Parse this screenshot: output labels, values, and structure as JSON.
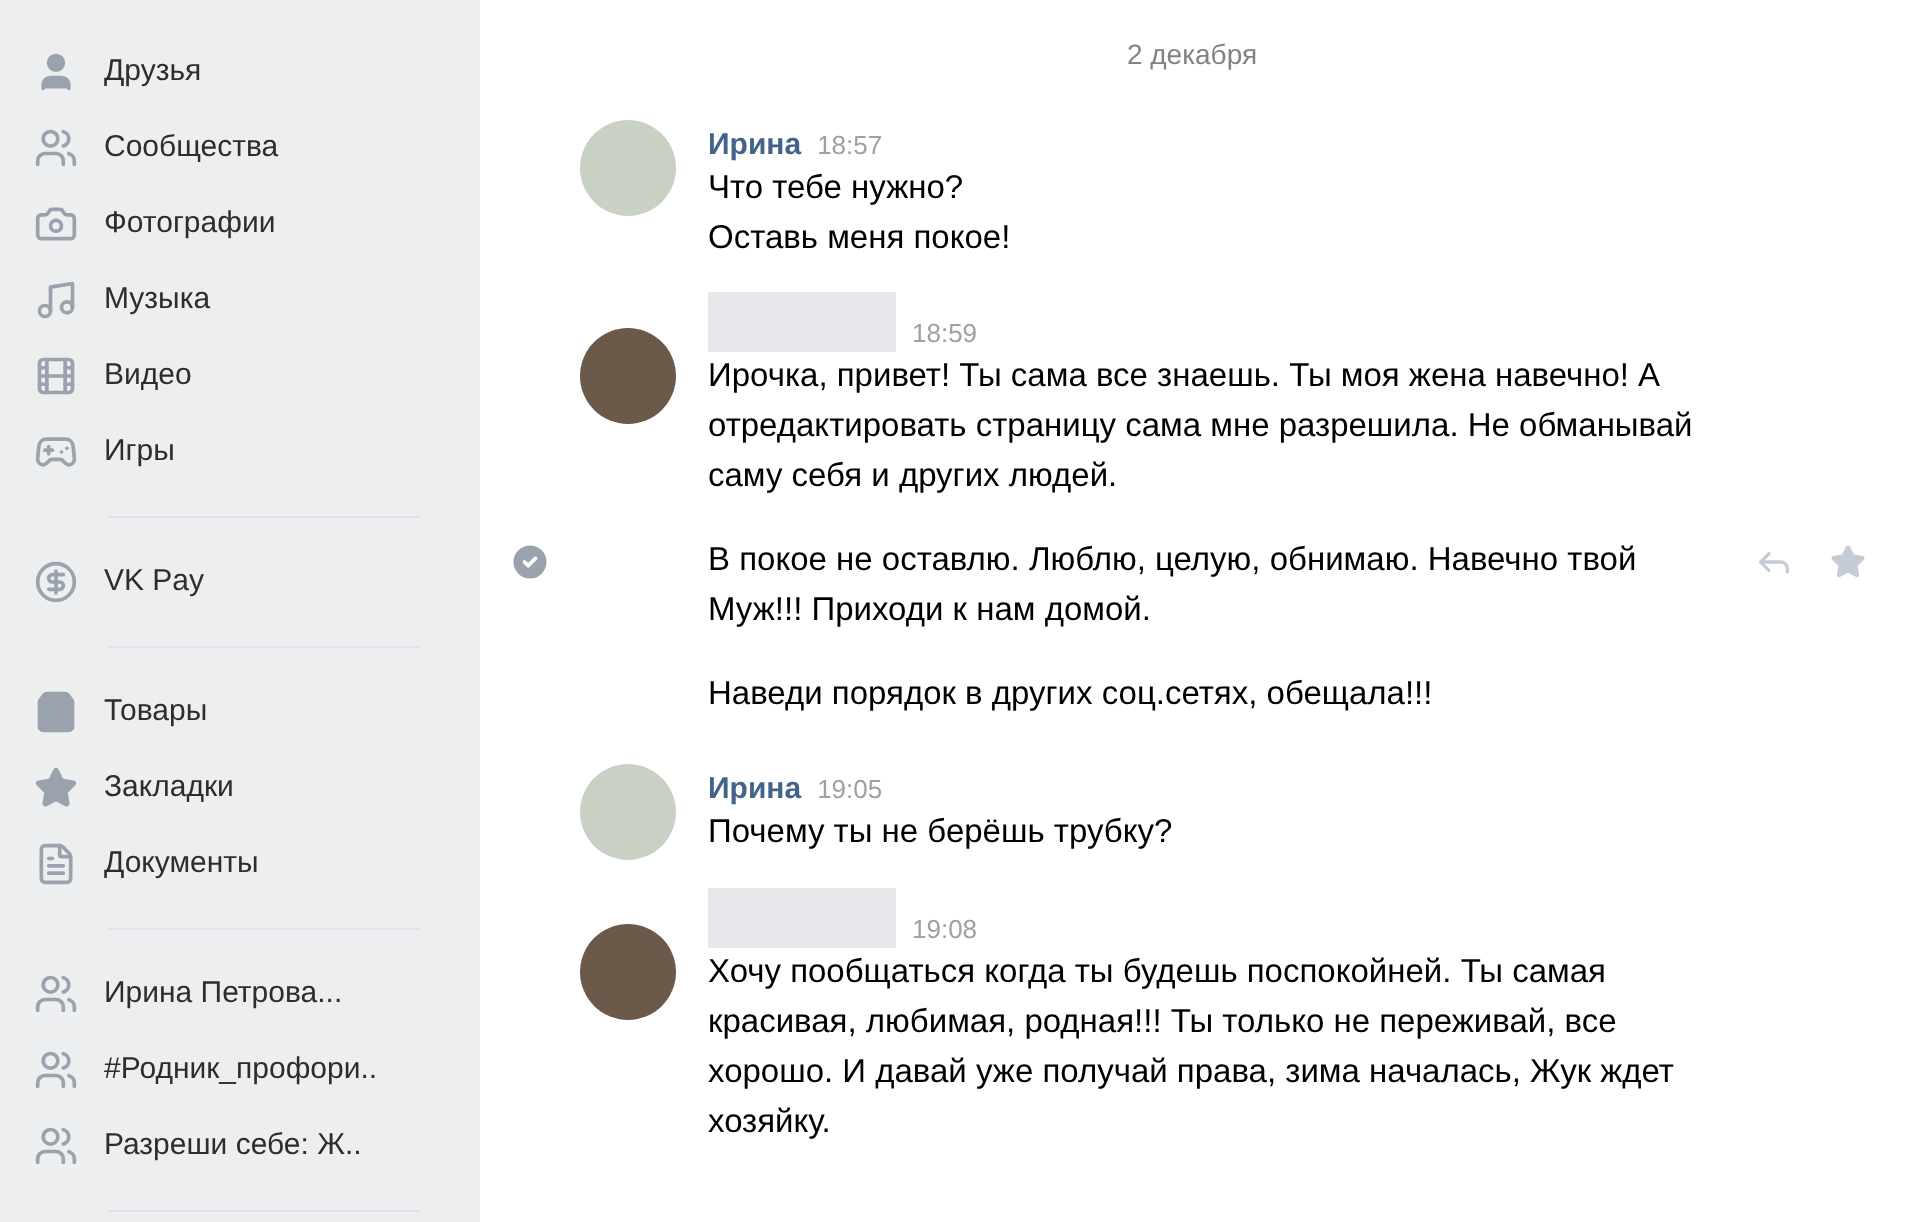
{
  "sidebar": {
    "sections": [
      {
        "items": [
          {
            "kind": "friends",
            "label": "Друзья"
          },
          {
            "kind": "groups",
            "label": "Сообщества"
          },
          {
            "kind": "photos",
            "label": "Фотографии"
          },
          {
            "kind": "music",
            "label": "Музыка"
          },
          {
            "kind": "video",
            "label": "Видео"
          },
          {
            "kind": "games",
            "label": "Игры"
          }
        ]
      },
      {
        "items": [
          {
            "kind": "pay",
            "label": "VK Pay"
          }
        ]
      },
      {
        "items": [
          {
            "kind": "market",
            "label": "Товары"
          },
          {
            "kind": "bookmarks",
            "label": "Закладки"
          },
          {
            "kind": "docs",
            "label": "Документы"
          }
        ]
      },
      {
        "items": [
          {
            "kind": "groups",
            "label": "Ирина Петрова..."
          },
          {
            "kind": "groups",
            "label": "#Родник_профори.."
          },
          {
            "kind": "groups",
            "label": "Разреши себе: Ж.."
          }
        ]
      }
    ]
  },
  "chat": {
    "date": "2 декабря",
    "groups": [
      {
        "author": "Ирина",
        "time": "18:57",
        "messages": [
          {
            "text": "Что тебе нужно?\nОставь меня покое!",
            "hovered": false
          }
        ]
      },
      {
        "time": "18:59",
        "messages": [
          {
            "text": "Ирочка, привет! Ты сама все знаешь. Ты моя жена навечно! А отредактировать страницу сама мне разрешила. Не обманывай саму себя и других людей.",
            "hovered": false
          },
          {
            "text": "В покое не оставлю. Люблю, целую, обнимаю. Навечно твой Муж!!! Приходи к нам домой.",
            "hovered": true
          },
          {
            "text": "Наведи порядок в других соц.сетях, обещала!!!",
            "hovered": false
          }
        ]
      },
      {
        "author": "Ирина",
        "time": "19:05",
        "messages": [
          {
            "text": "Почему ты не берёшь трубку?",
            "hovered": false
          }
        ]
      },
      {
        "time": "19:08",
        "messages": [
          {
            "text": "Хочу пообщаться когда ты будешь поспокойней. Ты самая красивая, любимая, родная!!! Ты только не переживай, все хорошо. И давай уже получай права, зима началась, Жук ждет хозяйку.",
            "hovered": false
          }
        ]
      }
    ]
  }
}
